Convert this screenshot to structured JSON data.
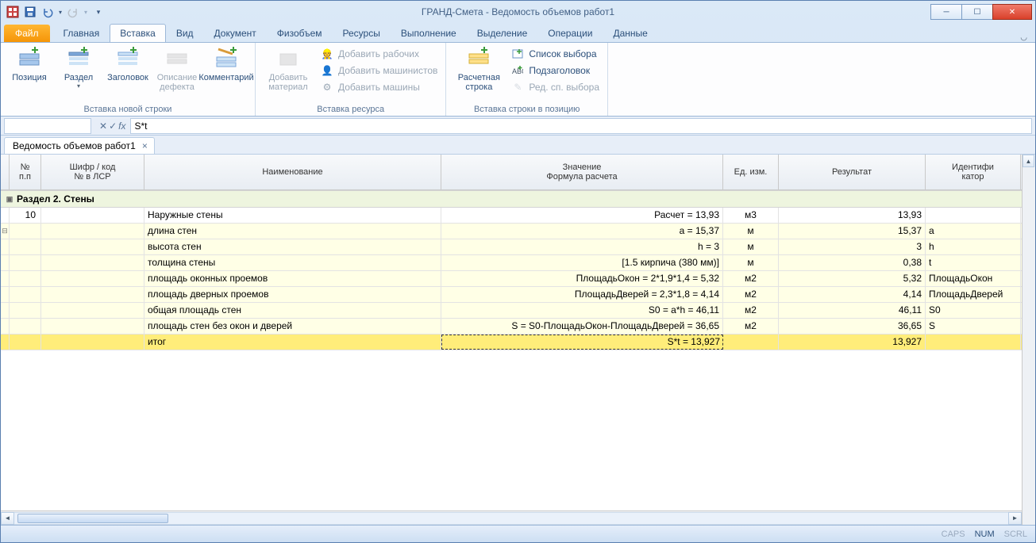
{
  "title": "ГРАНД-Смета - Ведомость объемов работ1",
  "tabs": {
    "file": "Файл",
    "items": [
      "Главная",
      "Вставка",
      "Вид",
      "Документ",
      "Физобъем",
      "Ресурсы",
      "Выполнение",
      "Выделение",
      "Операции",
      "Данные"
    ],
    "active": 1
  },
  "ribbon": {
    "group_insert_row": {
      "label": "Вставка новой строки",
      "position": "Позиция",
      "section": "Раздел",
      "header": "Заголовок",
      "defect": "Описание дефекта",
      "comment": "Комментарий"
    },
    "group_resource": {
      "label": "Вставка ресурса",
      "add_material": "Добавить материал",
      "add_workers": "Добавить рабочих",
      "add_machinists": "Добавить машинистов",
      "add_machines": "Добавить машины"
    },
    "group_position": {
      "label": "Вставка строки в позицию",
      "calc_row": "Расчетная строка",
      "choice_list": "Список выбора",
      "subheader": "Подзаголовок",
      "edit_list": "Ред. сп. выбора"
    }
  },
  "formula": {
    "value": "S*t",
    "fx": "fx"
  },
  "doc_tab": "Ведомость объемов работ1",
  "columns": {
    "c0a": "№",
    "c0b": "п.п",
    "c1a": "Шифр / код",
    "c1b": "№ в ЛСР",
    "c2": "Наименование",
    "c3a": "Значение",
    "c3b": "Формула расчета",
    "c4": "Ед. изм.",
    "c5": "Результат",
    "c6a": "Идентифи",
    "c6b": "катор"
  },
  "section": "Раздел 2. Стены",
  "main_row": {
    "num": "10",
    "name": "Наружные стены",
    "value": "Расчет = 13,93",
    "unit": "м3",
    "result": "13,93",
    "id": ""
  },
  "sub_rows": [
    {
      "name": "длина стен",
      "value": "a = 15,37",
      "unit": "м",
      "result": "15,37",
      "id": "a"
    },
    {
      "name": "высота стен",
      "value": "h = 3",
      "unit": "м",
      "result": "3",
      "id": "h"
    },
    {
      "name": "толщина стены",
      "value": "[1.5 кирпича (380 мм)]",
      "unit": "м",
      "result": "0,38",
      "id": "t"
    },
    {
      "name": "площадь оконных проемов",
      "value": "ПлощадьОкон = 2*1,9*1,4 = 5,32",
      "unit": "м2",
      "result": "5,32",
      "id": "ПлощадьОкон"
    },
    {
      "name": "площадь дверных проемов",
      "value": "ПлощадьДверей = 2,3*1,8 = 4,14",
      "unit": "м2",
      "result": "4,14",
      "id": "ПлощадьДверей"
    },
    {
      "name": "общая площадь стен",
      "value": "S0 = a*h = 46,11",
      "unit": "м2",
      "result": "46,11",
      "id": "S0"
    },
    {
      "name": "площадь стен без окон и дверей",
      "value": "S = S0-ПлощадьОкон-ПлощадьДверей = 36,65",
      "unit": "м2",
      "result": "36,65",
      "id": "S"
    }
  ],
  "selected_row": {
    "name": "итог",
    "value": "S*t = 13,927",
    "unit": "",
    "result": "13,927",
    "id": ""
  },
  "status": {
    "caps": "CAPS",
    "num": "NUM",
    "scrl": "SCRL"
  }
}
